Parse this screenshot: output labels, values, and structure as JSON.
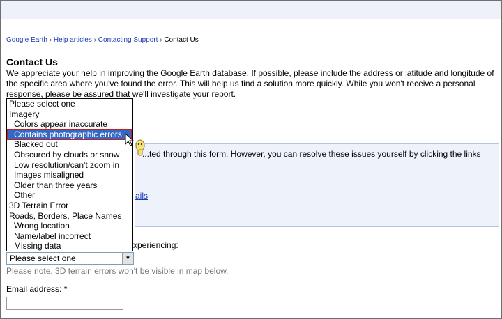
{
  "breadcrumb": {
    "items": [
      "Google Earth",
      "Help articles",
      "Contacting Support"
    ],
    "separator": "›",
    "current": "Contact Us"
  },
  "page": {
    "title": "Contact Us",
    "intro": "We appreciate your help in improving the Google Earth database. If possible, please include the address or latitude and longitude of the specific area where you've found the error. This will help us find a solution more quickly. While you won't receive a personal response, please be assured that we'll investigate your report."
  },
  "info_box": {
    "text": "...ted through this form. However, you can resolve these issues yourself by clicking the links",
    "link_fragment": "ails"
  },
  "issue": {
    "label_fragment": "xperiencing:",
    "select_value": "Please select one",
    "note": "Please note, 3D terrain errors won't be visible in map below."
  },
  "email": {
    "label": "Email address: *",
    "value": ""
  },
  "dropdown": {
    "options": [
      {
        "label": "Please select one",
        "kind": "group"
      },
      {
        "label": "Imagery",
        "kind": "group"
      },
      {
        "label": "Colors appear inaccurate",
        "kind": "child"
      },
      {
        "label": "Contains photographic errors",
        "kind": "child",
        "selected": true
      },
      {
        "label": "Blacked out",
        "kind": "child"
      },
      {
        "label": "Obscured by clouds or snow",
        "kind": "child"
      },
      {
        "label": "Low resolution/can't zoom in",
        "kind": "child"
      },
      {
        "label": "Images misaligned",
        "kind": "child"
      },
      {
        "label": "Older than three years",
        "kind": "child"
      },
      {
        "label": "Other",
        "kind": "child"
      },
      {
        "label": "3D Terrain Error",
        "kind": "group"
      },
      {
        "label": "Roads, Borders, Place Names",
        "kind": "group"
      },
      {
        "label": "Wrong location",
        "kind": "child"
      },
      {
        "label": "Name/label incorrect",
        "kind": "child"
      },
      {
        "label": "Missing data",
        "kind": "child"
      }
    ]
  },
  "colors": {
    "link": "#1a3ab0",
    "highlight": "#3169c6",
    "highlight_border": "#cc1b1b",
    "info_bg": "#edf2fb"
  },
  "icons": {
    "cursor": "hand-pointer-cursor-icon",
    "dropdown_arrow": "chevron-down-icon"
  }
}
